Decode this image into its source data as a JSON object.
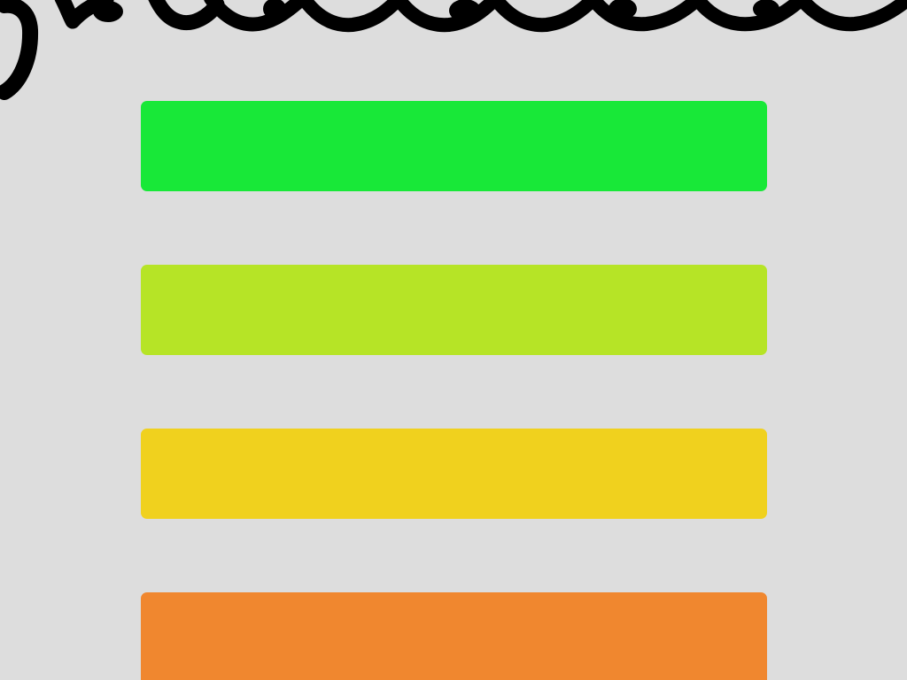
{
  "banner": {
    "icon": "handwritten-script-logo"
  },
  "choices": [
    {
      "name": "green-option",
      "color": "#18e838"
    },
    {
      "name": "yellow-green-option",
      "color": "#b6e426"
    },
    {
      "name": "yellow-option",
      "color": "#f0d11e"
    },
    {
      "name": "orange-option",
      "color": "#f0872f"
    }
  ]
}
